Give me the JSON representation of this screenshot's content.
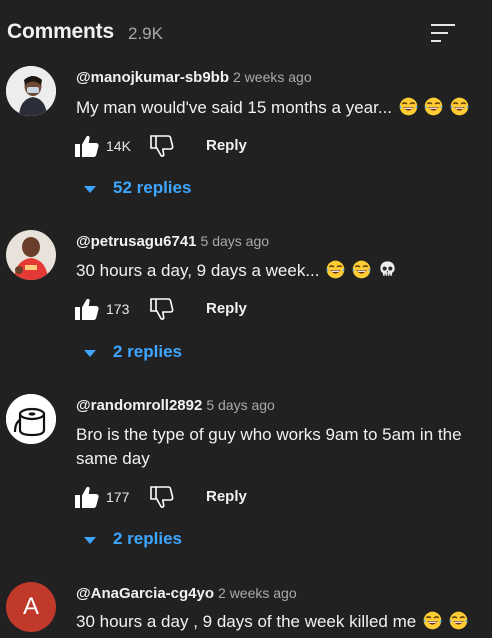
{
  "header": {
    "title": "Comments",
    "count": "2.9K",
    "sort_icon": "sort-icon"
  },
  "comments": [
    {
      "author": "@manojkumar-sb9bb",
      "time": "2 weeks ago",
      "text": "My man would've said 15 months a year...",
      "emojis": [
        "laugh-cry",
        "laugh-cry",
        "laugh-cry"
      ],
      "likes": "14K",
      "reply_label": "Reply",
      "replies_label": "52 replies"
    },
    {
      "author": "@petrusagu6741",
      "time": "5 days ago",
      "text": "30 hours a day, 9 days a week...",
      "emojis": [
        "laugh-cry",
        "laugh-cry",
        "skull"
      ],
      "likes": "173",
      "reply_label": "Reply",
      "replies_label": "2 replies"
    },
    {
      "author": "@randomroll2892",
      "time": "5 days ago",
      "text": "Bro is the type of guy who works 9am to 5am in the same day",
      "emojis": [],
      "likes": "177",
      "reply_label": "Reply",
      "replies_label": "2 replies"
    },
    {
      "author": "@AnaGarcia-cg4yo",
      "time": "2 weeks ago",
      "text": "30 hours a day , 9 days of the week killed me",
      "emojis": [
        "laugh-cry",
        "laugh-cry"
      ],
      "avatar_letter": "A",
      "avatar_color": "#c0392b"
    }
  ],
  "colors": {
    "background": "#212121",
    "link_blue": "#3ea6ff",
    "secondary_text": "#aaaaaa"
  }
}
